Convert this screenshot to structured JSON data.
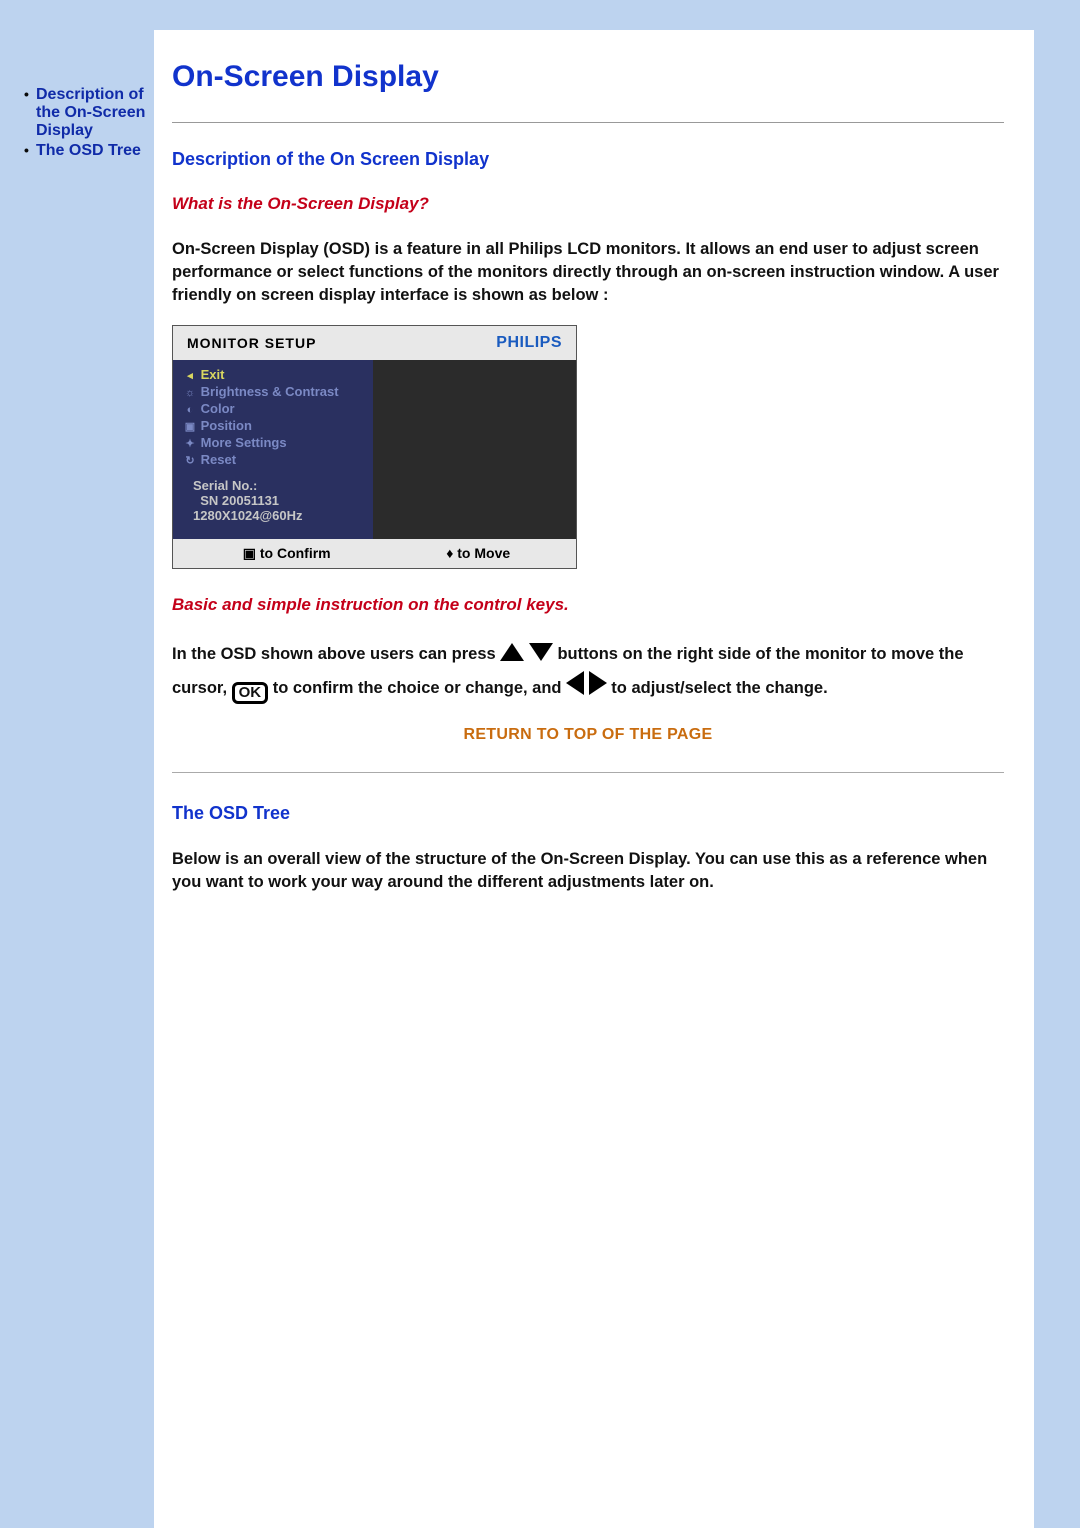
{
  "sidebar": {
    "links": [
      {
        "label": "Description of the On-Screen Display"
      },
      {
        "label": "The OSD Tree"
      }
    ]
  },
  "main": {
    "title": "On-Screen Display",
    "section1": {
      "heading": "Description of the On Screen Display",
      "q_heading": "What is the On-Screen Display?",
      "intro": "On-Screen Display (OSD) is a feature in all Philips LCD monitors. It allows an end user to adjust screen performance or select functions of the monitors directly through an on-screen instruction window. A user friendly on screen display interface is shown as below :"
    },
    "osd": {
      "title": "MONITOR SETUP",
      "brand": "PHILIPS",
      "menu": [
        {
          "label": "Exit",
          "highlight": true
        },
        {
          "label": "Brightness & Contrast",
          "highlight": false
        },
        {
          "label": "Color",
          "highlight": false
        },
        {
          "label": "Position",
          "highlight": false
        },
        {
          "label": "More Settings",
          "highlight": false
        },
        {
          "label": "Reset",
          "highlight": false
        }
      ],
      "serial_label": "Serial No.:",
      "serial_value": "SN 20051131",
      "resolution": "1280X1024@60Hz",
      "foot_confirm": "to Confirm",
      "foot_move": "to Move"
    },
    "basic_heading": "Basic and simple instruction on the control keys.",
    "instruction": {
      "p1a": "In the OSD shown above users can press ",
      "p1b": " buttons on the right side of the monitor to move the cursor,",
      "p1c": " to confirm the choice or change, and ",
      "p1d": " to adjust/select the change."
    },
    "return_link": "RETURN TO TOP OF THE PAGE",
    "section2": {
      "heading": "The OSD Tree",
      "body": "Below is an overall view of the structure of the On-Screen Display. You can use this as a reference when you want to work your way around the different adjustments later on."
    }
  }
}
